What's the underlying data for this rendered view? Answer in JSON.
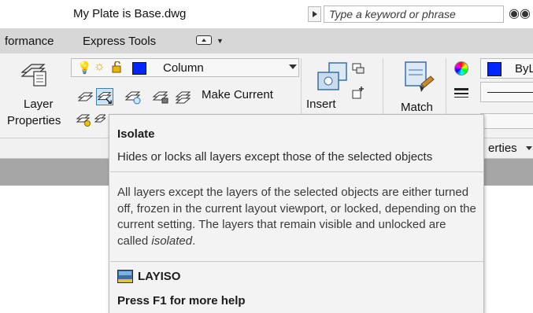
{
  "window": {
    "title": "My Plate is Base.dwg",
    "search_placeholder": "Type a keyword or phrase"
  },
  "menu": {
    "tabs": [
      {
        "label": "formance"
      },
      {
        "label": "Express Tools"
      }
    ]
  },
  "ribbon": {
    "layer_properties": {
      "line1": "Layer",
      "line2": "Properties"
    },
    "layer_combo": {
      "current_layer": "Column",
      "color": "#0026ff"
    },
    "make_current_label": "Make Current",
    "insert_label": "Insert",
    "match_label": "Match",
    "color_combo": {
      "value": "ByL",
      "color": "#0026ff"
    },
    "properties_panel_title": "erties"
  },
  "tooltip": {
    "title": "Isolate",
    "summary": "Hides or locks all layers except those of the selected objects",
    "description_main": "All layers except the layers of the selected objects are either turned off, frozen in the current layout viewport, or locked, depending on the current setting. The layers that remain visible and unlocked are called ",
    "description_em": "isolated",
    "description_end": ".",
    "command": "LAYISO",
    "help": "Press F1 for more help"
  }
}
